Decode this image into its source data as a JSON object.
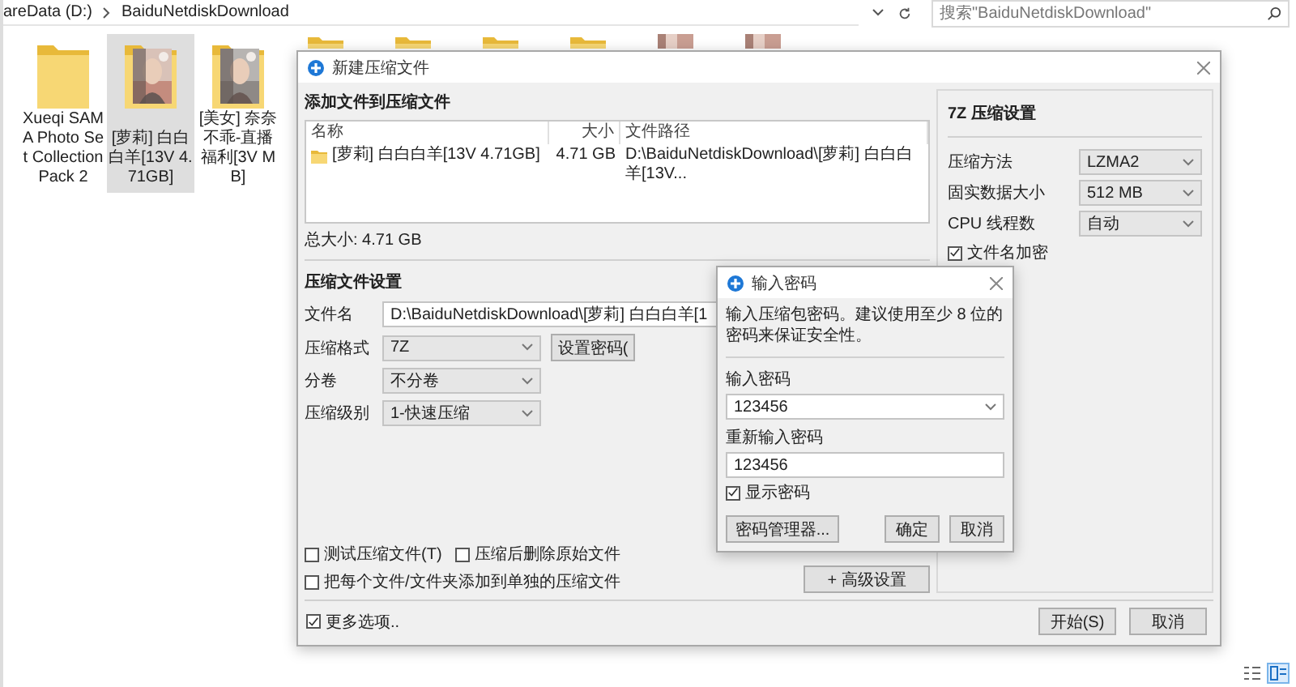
{
  "explorer": {
    "path": [
      "areData (D:)",
      "BaiduNetdiskDownload"
    ],
    "search": {
      "placeholder": "搜索\"BaiduNetdiskDownload\""
    },
    "items": [
      {
        "label": "Xueqi SAMA Photo Set Collection Pack 2",
        "kind": "folder",
        "selected": false
      },
      {
        "label": "[萝莉] 白白白羊[13V 4.71GB]",
        "kind": "photo_folder",
        "selected": true
      },
      {
        "label": "[美女] 奈奈不乖-直播福利[3V MB]",
        "kind": "photo_folder",
        "selected": false
      }
    ],
    "covered_items": [
      {
        "kind": "folder"
      },
      {
        "kind": "folder"
      },
      {
        "kind": "folder"
      },
      {
        "kind": "folder"
      },
      {
        "kind": "photo_folder"
      },
      {
        "kind": "photo_folder"
      }
    ],
    "view_buttons": [
      {
        "kind": "details",
        "selected": false
      },
      {
        "kind": "tiles",
        "selected": true
      }
    ]
  },
  "archive_dialog": {
    "title": "新建压缩文件",
    "add_heading": "添加文件到压缩文件",
    "file_list": {
      "columns": [
        "名称",
        "大小",
        "文件路径"
      ],
      "rows": [
        {
          "name": "[萝莉] 白白白羊[13V 4.71GB]",
          "size": "4.71 GB",
          "path": "D:\\BaiduNetdiskDownload\\[萝莉] 白白白羊[13V..."
        }
      ]
    },
    "total_size": "总大小: 4.71 GB",
    "settings_heading": "压缩文件设置",
    "fields": [
      {
        "label": "文件名",
        "kind": "input",
        "value": "D:\\BaiduNetdiskDownload\\[萝莉] 白白白羊[1"
      },
      {
        "label": "压缩格式",
        "kind": "select",
        "value": "7Z",
        "button": "设置密码("
      },
      {
        "label": "分卷",
        "kind": "select",
        "value": "不分卷"
      },
      {
        "label": "压缩级别",
        "kind": "select",
        "value": "1-快速压缩"
      }
    ],
    "advanced_button": "+ 高级设置",
    "options": [
      {
        "label": "测试压缩文件(T)",
        "checked": false
      },
      {
        "label": "压缩后删除原始文件",
        "checked": false
      },
      {
        "label": "把每个文件/文件夹添加到单独的压缩文件",
        "checked": false
      }
    ],
    "more_options": {
      "label": "更多选项..",
      "checked": true
    },
    "buttons": [
      "开始(S)",
      "取消"
    ],
    "right_panel": {
      "heading": "7Z 压缩设置",
      "rows": [
        {
          "label": "压缩方法",
          "value": "LZMA2"
        },
        {
          "label": "固实数据大小",
          "value": "512 MB"
        },
        {
          "label": "CPU 线程数",
          "value": "自动"
        }
      ],
      "encrypt_names": {
        "label": "文件名加密",
        "checked": true
      }
    }
  },
  "password_dialog": {
    "title": "输入密码",
    "hint": "输入压缩包密码。建议使用至少 8 位的密码来保证安全性。",
    "password_label": "输入密码",
    "password_value": "123456",
    "confirm_label": "重新输入密码",
    "confirm_value": "123456",
    "show_password": {
      "label": "显示密码",
      "checked": true
    },
    "buttons": [
      "密码管理器...",
      "确定",
      "取消"
    ]
  }
}
